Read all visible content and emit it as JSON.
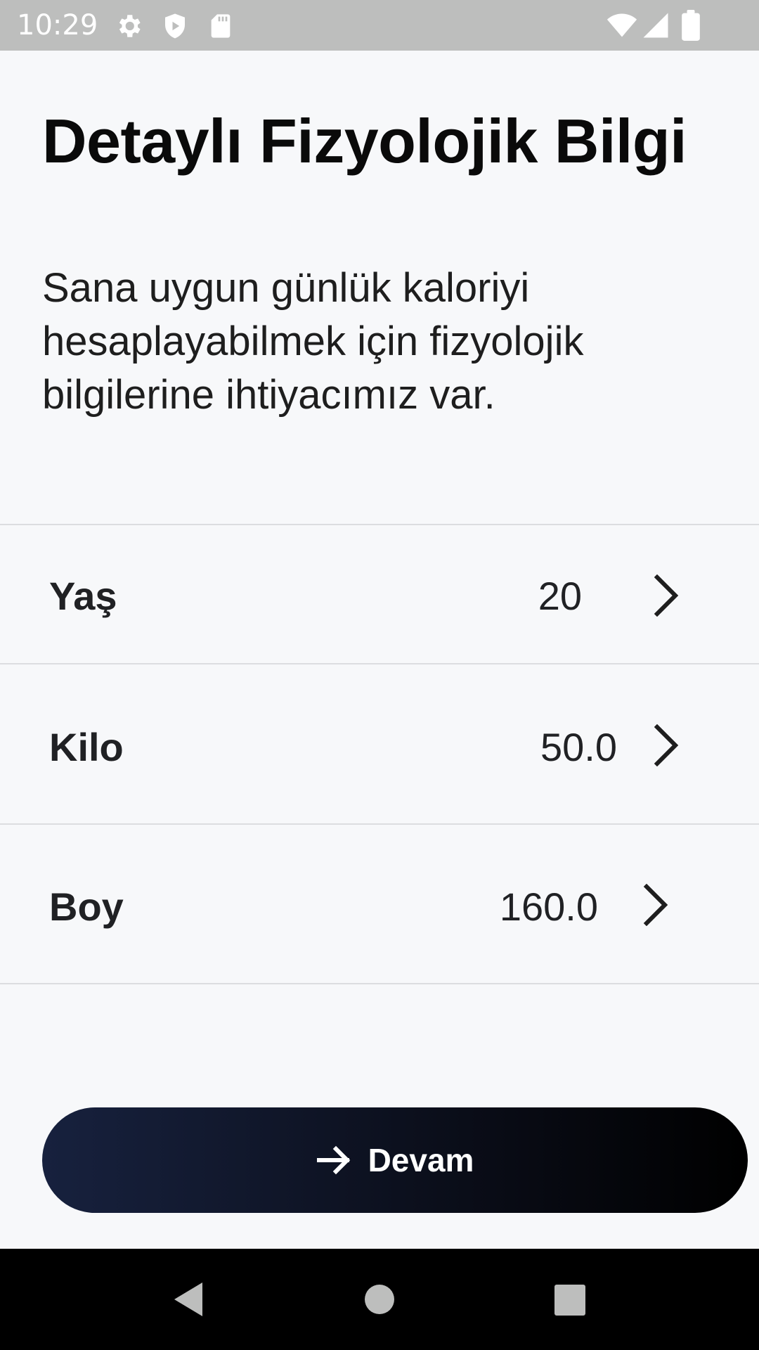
{
  "status_bar": {
    "time": "10:29",
    "icons": [
      "gear-icon",
      "shield-play-icon",
      "sd-card-icon",
      "wifi-icon",
      "signal-icon",
      "battery-icon"
    ]
  },
  "header": {
    "title": "Detaylı Fizyolojik Bilgi",
    "description": "Sana uygun günlük kaloriyi hesaplayabilmek için fizyolojik bilgilerine ihtiyacımız var."
  },
  "fields": [
    {
      "label": "Yaş",
      "value": "20"
    },
    {
      "label": "Kilo",
      "value": "50.0"
    },
    {
      "label": "Boy",
      "value": "160.0"
    }
  ],
  "continue_button": {
    "label": "Devam",
    "icon": "arrow-right-icon"
  },
  "nav_bar": {
    "icons": [
      "back-icon",
      "home-icon",
      "recents-icon"
    ]
  },
  "colors": {
    "background": "#F7F8FA",
    "status_bar": "#BDBEBD",
    "button_gradient_start": "#17213E",
    "button_gradient_end": "#000000",
    "divider": "#DCDDE0"
  }
}
